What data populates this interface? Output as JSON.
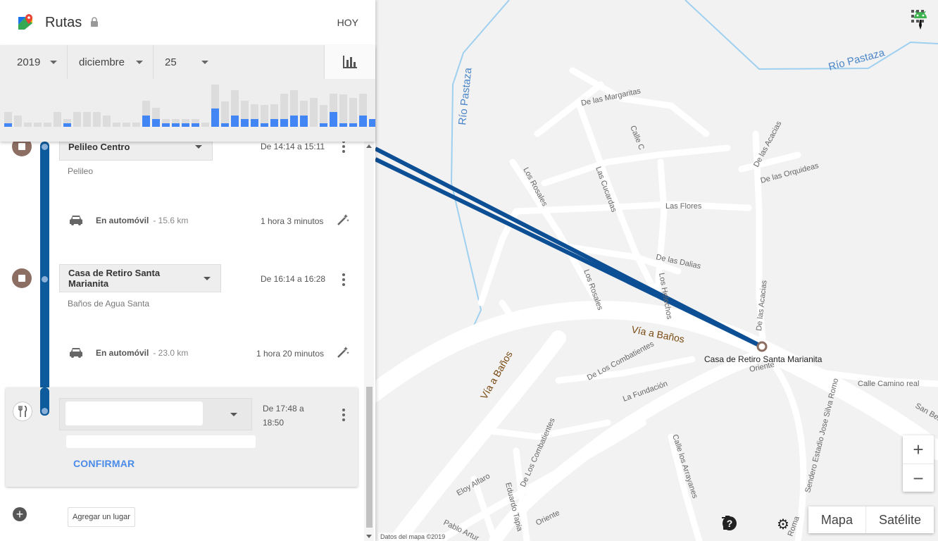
{
  "app": {
    "title": "Rutas",
    "today_label": "HOY"
  },
  "date": {
    "year": "2019",
    "month": "diciembre",
    "day": "25"
  },
  "histogram": {
    "grey": [
      16,
      16,
      6,
      6,
      6,
      21,
      6,
      21,
      21,
      21,
      16,
      6,
      6,
      6,
      21,
      16,
      6,
      6,
      6,
      6,
      6,
      51,
      31,
      36,
      26,
      21,
      26,
      21,
      36,
      36,
      21,
      41,
      26,
      26,
      41,
      36,
      31
    ],
    "blue": [
      5,
      0,
      0,
      0,
      0,
      0,
      5,
      0,
      0,
      0,
      0,
      0,
      0,
      0,
      16,
      11,
      5,
      5,
      5,
      5,
      0,
      26,
      5,
      16,
      11,
      11,
      5,
      11,
      11,
      16,
      16,
      0,
      5,
      21,
      5,
      5,
      16,
      11,
      16
    ],
    "blue_color": "#4285f4",
    "selected_color": "#1a56c8",
    "grey_color": "#dcdcdc"
  },
  "timeline": {
    "stops": [
      {
        "name": "Pelileo Centro",
        "sub": "Pelileo",
        "time": "De 14:14 a 15:11"
      },
      {
        "name": "Casa de Retiro Santa Marianita",
        "sub": "Baños de Agua Santa",
        "time": "De 16:14 a 16:28"
      }
    ],
    "moves": [
      {
        "mode": "En automóvil",
        "distance": "- 15.6 km",
        "duration": "1 hora 3 minutos"
      },
      {
        "mode": "En automóvil",
        "distance": "- 23.0 km",
        "duration": "1 hora 20 minutos"
      }
    ],
    "pending": {
      "time_line1": "De 17:48 a",
      "time_line2": "18:50",
      "confirm_label": "CONFIRMAR"
    },
    "add_place_label": "Agregar un lugar"
  },
  "map": {
    "attribution": "Datos del mapa ©2019",
    "destination_label": "Casa de Retiro Santa Marianita",
    "rivers": [
      "Río Pastaza",
      "Río Pastaza"
    ],
    "major_roads": [
      "Vía a Baños",
      "Vía a Baños"
    ],
    "streets": [
      "De las Margaritas",
      "Calle C",
      "De las Acacias",
      "De las Orquideas",
      "Los Rosales",
      "Las Cucardas",
      "Las Flores",
      "De las Dalias",
      "Los Rosales",
      "Los Helechos",
      "De las Acacias",
      "De Los Combatientes",
      "Oriente",
      "La Fundación",
      "Calle Camino real",
      "San Ben",
      "Sendero Estadio Jose Silva Romo",
      "Calle los Arrayanes",
      "De Los Combatientes",
      "Eloy Alfaro",
      "Eduardo Tapia",
      "Oriente",
      "Pablo Artur",
      "Roma"
    ],
    "maptype": {
      "map": "Mapa",
      "satellite": "Satélite"
    },
    "route_color": "#0d4f94"
  }
}
